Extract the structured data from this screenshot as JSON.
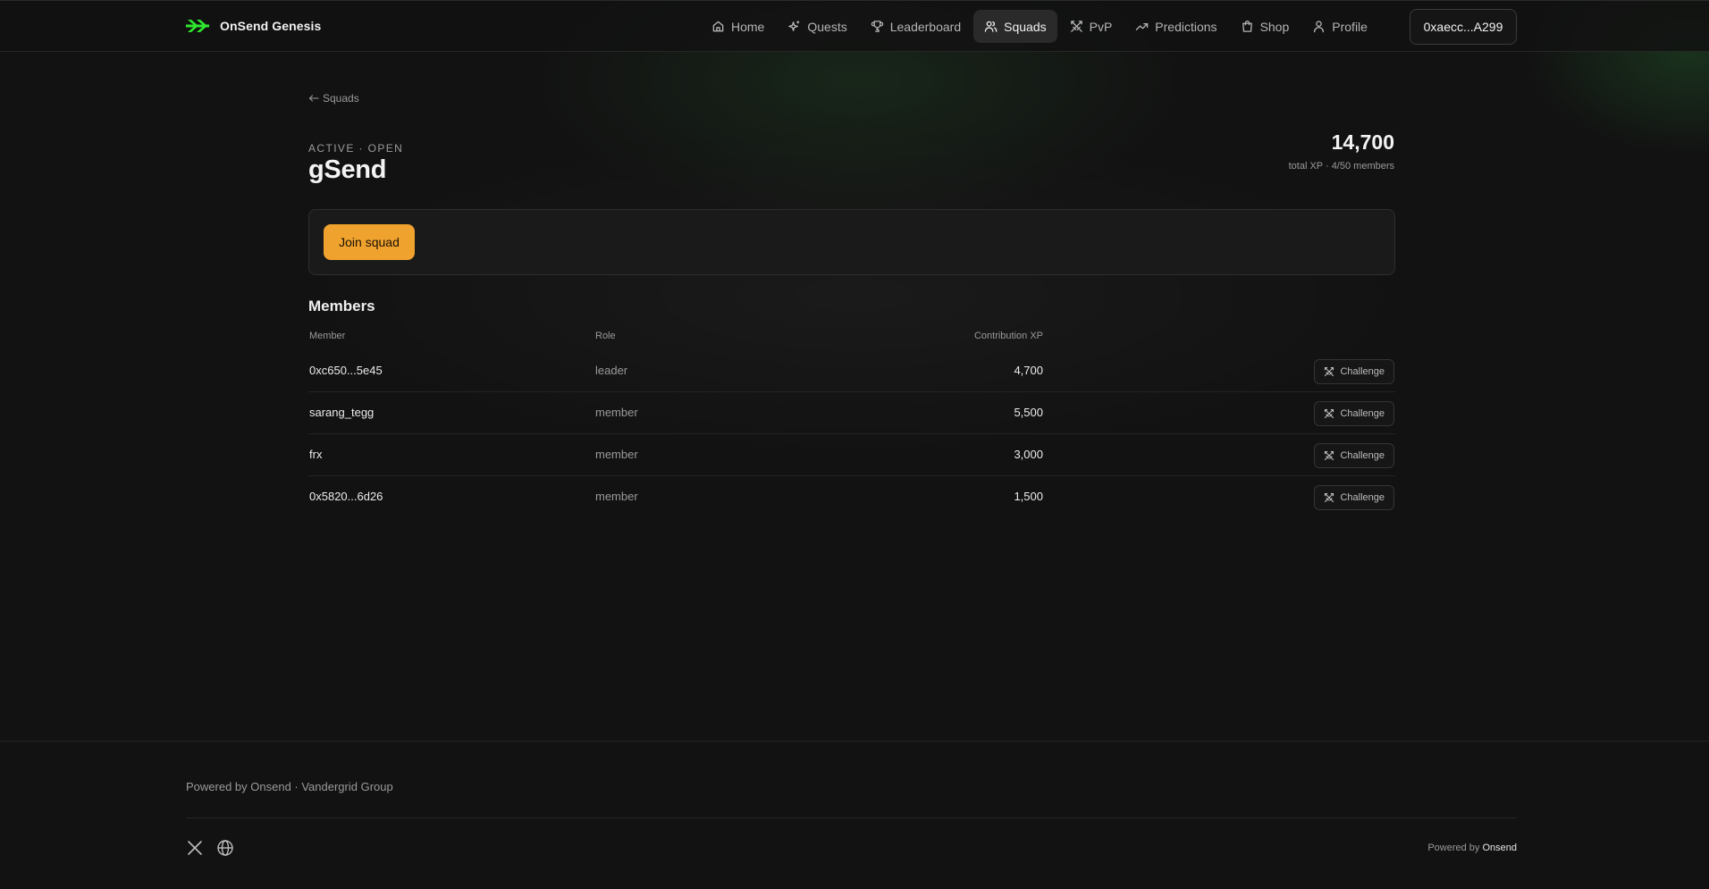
{
  "header": {
    "brand": "OnSend Genesis",
    "nav": [
      {
        "label": "Home",
        "icon": "home-icon"
      },
      {
        "label": "Quests",
        "icon": "sparkle-icon"
      },
      {
        "label": "Leaderboard",
        "icon": "trophy-icon"
      },
      {
        "label": "Squads",
        "icon": "users-icon",
        "active": true
      },
      {
        "label": "PvP",
        "icon": "swords-icon"
      },
      {
        "label": "Predictions",
        "icon": "trending-up-icon"
      },
      {
        "label": "Shop",
        "icon": "shopping-bag-icon"
      },
      {
        "label": "Profile",
        "icon": "user-icon"
      }
    ],
    "wallet": "0xaecc...A299"
  },
  "page": {
    "back_label": "Squads",
    "status": "ACTIVE · OPEN",
    "squad_name": "gSend",
    "total_xp": "14,700",
    "total_sub": "total XP · 4/50 members",
    "join_label": "Join squad"
  },
  "members": {
    "title": "Members",
    "columns": [
      "Member",
      "Role",
      "Contribution XP"
    ],
    "challenge_label": "Challenge",
    "rows": [
      {
        "member": "0xc650...5e45",
        "role": "leader",
        "xp": "4,700"
      },
      {
        "member": "sarang_tegg",
        "role": "member",
        "xp": "5,500"
      },
      {
        "member": "frx",
        "role": "member",
        "xp": "3,000"
      },
      {
        "member": "0x5820...6d26",
        "role": "member",
        "xp": "1,500"
      }
    ]
  },
  "footer": {
    "powered_left": "Powered by Onsend · Vandergrid Group",
    "powered_right_prefix": "Powered by",
    "powered_right_brand": "Onsend",
    "social": [
      "x-icon",
      "globe-icon"
    ]
  },
  "colors": {
    "accent": "#f0a22e",
    "brand": "#2ee82e",
    "background": "#121212"
  }
}
